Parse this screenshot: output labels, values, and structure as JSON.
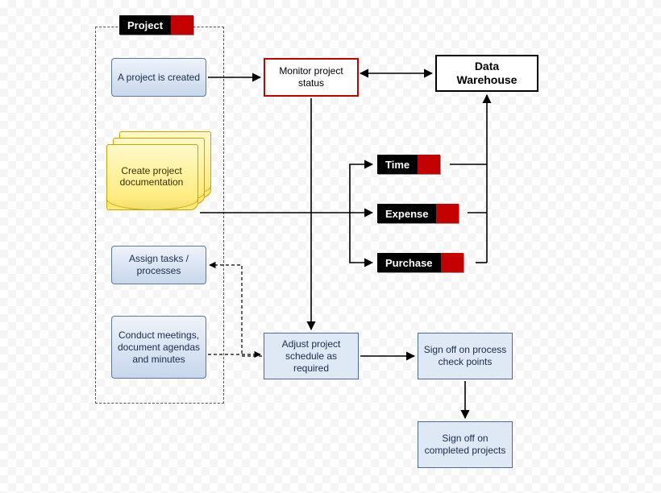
{
  "tags": {
    "project": "Project",
    "time": "Time",
    "expense": "Expense",
    "purchase": "Purchase"
  },
  "nodes": {
    "create_project": "A project is created",
    "monitor": "Monitor project status",
    "data_warehouse": "Data\nWarehouse",
    "documentation": "Create project documentation",
    "assign_tasks": "Assign tasks / processes",
    "meetings": "Conduct meetings, document agendas and minutes",
    "adjust_schedule": "Adjust project schedule as required",
    "signoff_checkpoints": "Sign off on process check points",
    "signoff_completed": "Sign off on completed projects"
  },
  "colors": {
    "red": "#c40000",
    "black": "#000000",
    "blue_border": "#5a7aa3"
  }
}
